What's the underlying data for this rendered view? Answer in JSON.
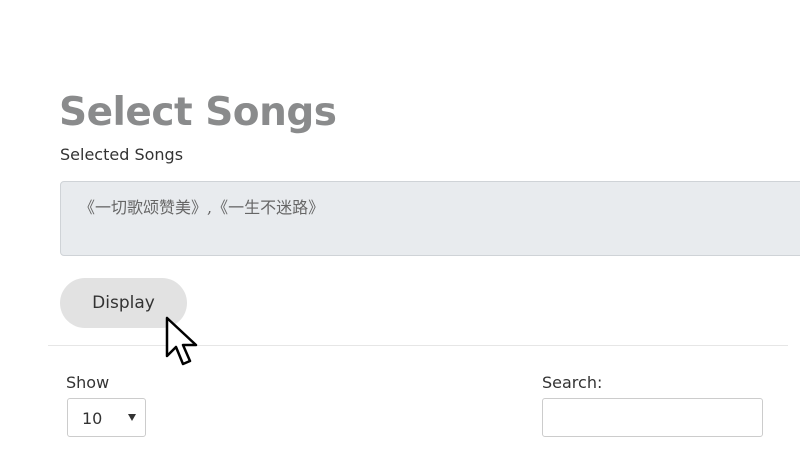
{
  "header": {
    "title": "Select Songs"
  },
  "selection": {
    "label": "Selected Songs",
    "value": "《一切歌颂赞美》,《一生不迷路》"
  },
  "actions": {
    "display_label": "Display"
  },
  "table_controls": {
    "show_label": "Show",
    "page_size": "10",
    "search_label": "Search:",
    "search_value": ""
  },
  "icons": {
    "dropdown": "caret-down-icon",
    "pointer": "mouse-cursor-icon"
  }
}
